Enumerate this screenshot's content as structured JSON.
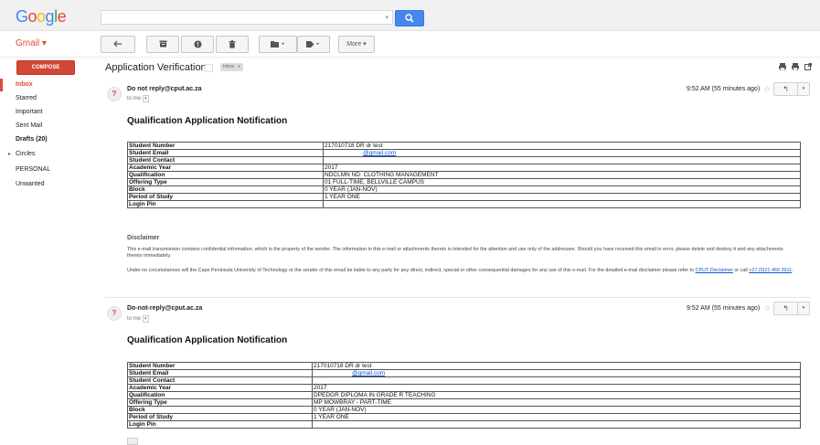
{
  "header": {
    "logo": [
      "G",
      "o",
      "o",
      "g",
      "l",
      "e"
    ],
    "search": {
      "placeholder": "",
      "caret": "▾"
    }
  },
  "app": {
    "name": "Gmail ▾"
  },
  "toolbar": {
    "more_label": "More ▾"
  },
  "sidebar": {
    "compose": "COMPOSE",
    "items": [
      {
        "label": "Inbox"
      },
      {
        "label": "Starred"
      },
      {
        "label": "Important"
      },
      {
        "label": "Sent Mail"
      },
      {
        "label": "Drafts (20)"
      },
      {
        "label": "Circles"
      },
      {
        "label": "PERSONAL"
      },
      {
        "label": "Unwanted"
      }
    ]
  },
  "thread": {
    "subject": "Application Verification",
    "label_tag": "Inbox",
    "label_remove": "x"
  },
  "messages": [
    {
      "avatar": "?",
      "sender": "Do not reply@cput.ac.za",
      "to": "to me",
      "time": "9:52 AM (55 minutes ago)",
      "heading": "Qualification Application Notification",
      "rows": [
        {
          "key": "Student Number",
          "value": "217010718 DR dr test"
        },
        {
          "key": "Student Email",
          "value": "@gmail.com"
        },
        {
          "key": "Student Contact",
          "value": ""
        },
        {
          "key": "Academic Year",
          "value": "2017"
        },
        {
          "key": "Qualification",
          "value": "NDCLMN ND: CLOTHING MANAGEMENT"
        },
        {
          "key": "Offering Type",
          "value": "01 FULL-TIME, BELLVILLE CAMPUS"
        },
        {
          "key": "Block",
          "value": "0 YEAR (JAN-NOV)"
        },
        {
          "key": "Period of Study",
          "value": "1 YEAR ONE"
        },
        {
          "key": "Login Pin",
          "value": ""
        }
      ]
    },
    {
      "avatar": "?",
      "sender": "Do-not-reply@cput.ac.za",
      "to": "to me",
      "time": "9:52 AM (55 minutes ago)",
      "heading": "Qualification Application Notification",
      "rows": [
        {
          "key": "Student Number",
          "value": "217010718 DR dr test"
        },
        {
          "key": "Student Email",
          "value": "@gmail.com"
        },
        {
          "key": "Student Contact",
          "value": ""
        },
        {
          "key": "Academic Year",
          "value": "2017"
        },
        {
          "key": "Qualification",
          "value": "DPEDGR DIPLOMA IN GRADE R TEACHING"
        },
        {
          "key": "Offering Type",
          "value": "MP MOWBRAY - PART-TIME"
        },
        {
          "key": "Block",
          "value": "0 YEAR (JAN-NOV)"
        },
        {
          "key": "Period of Study",
          "value": "1 YEAR ONE"
        },
        {
          "key": "Login Pin",
          "value": ""
        }
      ]
    }
  ],
  "disclaimer": {
    "title": "Disclaimer",
    "p1": "This e-mail transmission contains confidential information, which is the property of the sender. The information in this e-mail or attachments thereto is intended for the attention and use only of the addressee. Should you have received this email in error, please delete and destroy it and any attachments thereto immediately.",
    "p2_pre": "Under no circumstances will the Cape Peninsula University of Technology or the sender of this email be liable to any party for any direct, indirect, special or other consequential damages for any use of this e-mail. For the detailed e-mail disclaimer please refer to ",
    "p2_link1": "CPUT Disclaimer",
    "p2_mid": " or call ",
    "p2_link2": "+27 (0)21 460 3911",
    "p2_post": "."
  },
  "trimmed": "..."
}
